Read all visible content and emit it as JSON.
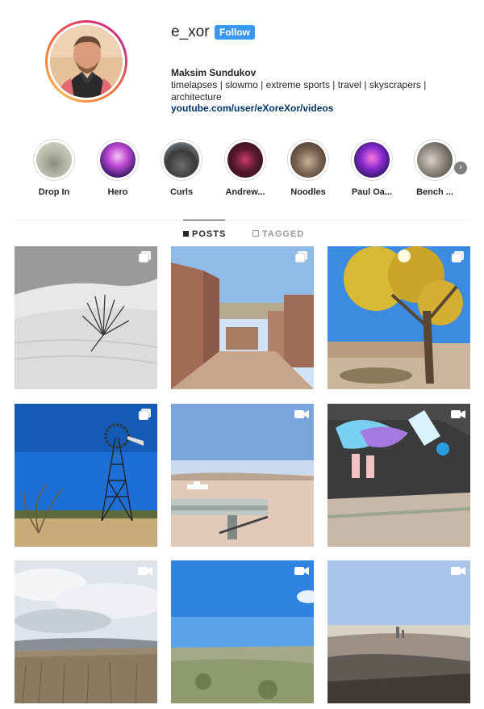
{
  "profile": {
    "username": "e_xor",
    "follow_label": "Follow",
    "full_name": "Maksim Sundukov",
    "bio": "timelapses | slowmo | extreme sports | travel | skyscrapers | architecture",
    "link": "youtube.com/user/eXoreXor/videos"
  },
  "highlights": [
    {
      "label": "Drop In"
    },
    {
      "label": "Hero"
    },
    {
      "label": "Curls"
    },
    {
      "label": "Andrew..."
    },
    {
      "label": "Noodles"
    },
    {
      "label": "Paul Oa..."
    },
    {
      "label": "Bench ..."
    }
  ],
  "tabs": {
    "posts": "POSTS",
    "tagged": "TAGGED"
  },
  "posts": [
    {
      "badge": "carousel-icon"
    },
    {
      "badge": "carousel-icon"
    },
    {
      "badge": "carousel-icon"
    },
    {
      "badge": "carousel-icon"
    },
    {
      "badge": "video-icon"
    },
    {
      "badge": "video-icon"
    },
    {
      "badge": "video-icon"
    },
    {
      "badge": "video-icon"
    },
    {
      "badge": "video-icon"
    }
  ],
  "colors": {
    "follow_button": "#3897f0",
    "link": "#003569",
    "avatar_ring": "#e1306c"
  }
}
